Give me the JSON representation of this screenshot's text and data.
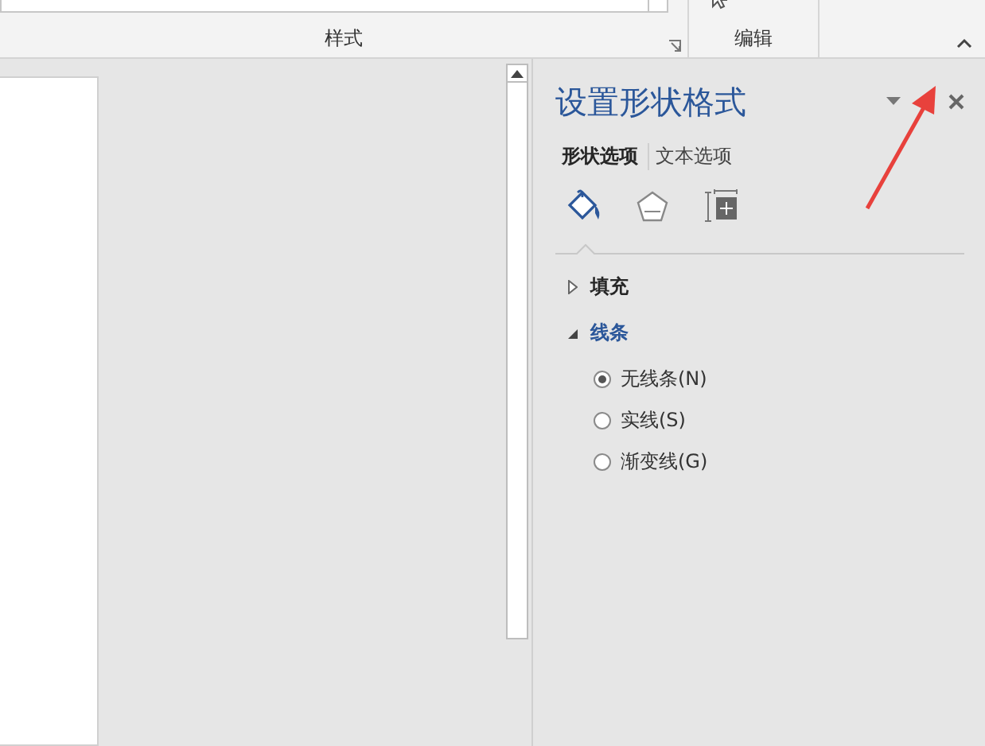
{
  "ribbon": {
    "groups": [
      {
        "kind": "gallery",
        "label": "样式"
      },
      {
        "kind": "commands",
        "label": "编辑"
      }
    ]
  },
  "panel": {
    "title": "设置形状格式",
    "tabs": [
      {
        "label": "形状选项",
        "selected": true
      },
      {
        "label": "文本选项",
        "selected": false
      }
    ],
    "icon_tabs": [
      {
        "kind": "fill",
        "selected": true
      },
      {
        "kind": "shape",
        "selected": false
      },
      {
        "kind": "size",
        "selected": false
      }
    ],
    "sections": [
      {
        "label": "填充",
        "expanded": false
      },
      {
        "label": "线条",
        "expanded": true,
        "options": [
          {
            "label": "无线条(N)",
            "selected": true
          },
          {
            "label": "实线(S)",
            "selected": false
          },
          {
            "label": "渐变线(G)",
            "selected": false
          }
        ]
      }
    ]
  }
}
